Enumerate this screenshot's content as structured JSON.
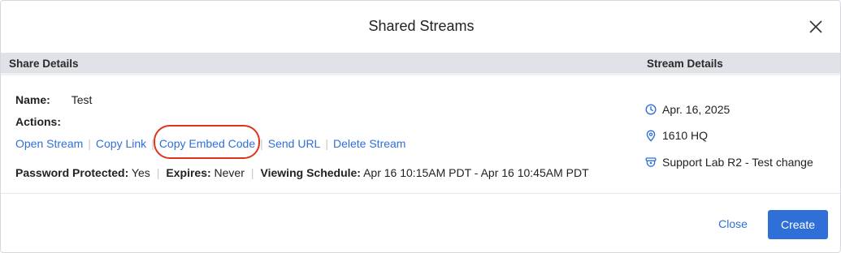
{
  "dialog": {
    "title": "Shared Streams"
  },
  "sections": {
    "share_details": "Share Details",
    "stream_details": "Stream Details"
  },
  "share": {
    "name_label": "Name:",
    "name_value": "Test",
    "actions_label": "Actions:",
    "actions": [
      {
        "label": "Open Stream"
      },
      {
        "label": "Copy Link"
      },
      {
        "label": "Copy Embed Code"
      },
      {
        "label": "Send URL"
      },
      {
        "label": "Delete Stream"
      }
    ],
    "password_label": "Password Protected:",
    "password_value": "Yes",
    "expires_label": "Expires:",
    "expires_value": "Never",
    "schedule_label": "Viewing Schedule:",
    "schedule_value": "Apr 16 10:15AM PDT - Apr 16 10:45AM PDT"
  },
  "stream": {
    "date": "Apr. 16, 2025",
    "location": "1610 HQ",
    "camera": "Support Lab R2 - Test change"
  },
  "footer": {
    "close_label": "Close",
    "create_label": "Create"
  },
  "colors": {
    "accent": "#2f6fd8",
    "highlight": "#e0321c",
    "section_bar": "#dfe2e7"
  },
  "icons": {
    "close": "close-icon",
    "date": "clock-icon",
    "location": "location-pin-icon",
    "camera": "camera-icon"
  }
}
